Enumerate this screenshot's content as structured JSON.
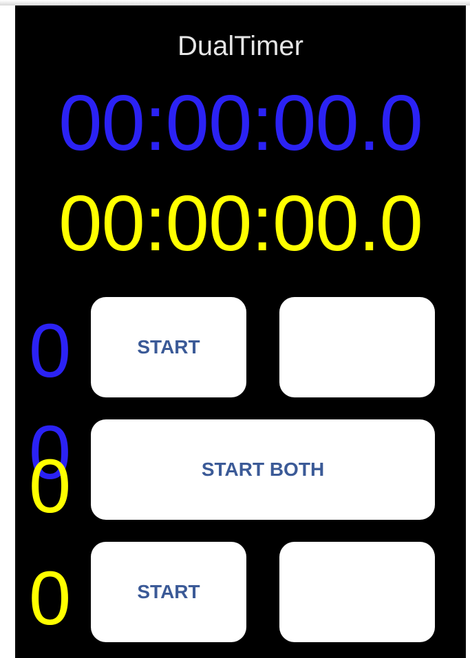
{
  "app": {
    "title": "DualTimer"
  },
  "colors": {
    "timer1": "#2b22f4",
    "timer2": "#ffff00",
    "button_text": "#3b5a97",
    "background": "#000000"
  },
  "timer1": {
    "time": "00:00:00.0",
    "lap_count_top": "0",
    "lap_count_bottom": "0",
    "start_label": "START",
    "second_button_label": ""
  },
  "timer2": {
    "time": "00:00:00.0",
    "lap_count_top": "0",
    "lap_count_bottom": "0",
    "start_label": "START",
    "second_button_label": ""
  },
  "controls": {
    "start_both_label": "START BOTH"
  }
}
